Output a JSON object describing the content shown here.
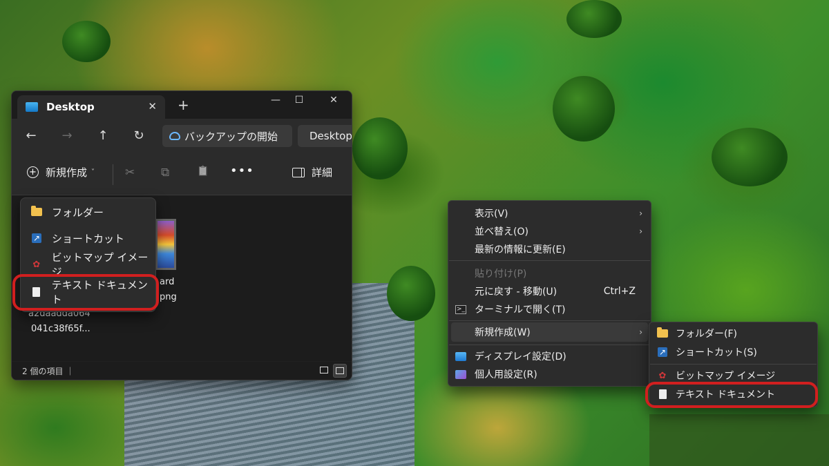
{
  "explorer": {
    "tab_title": "Desktop",
    "tab_close": "✕",
    "new_tab": "+",
    "window_controls": {
      "minimize": "—",
      "maximize": "☐",
      "close": "✕"
    },
    "nav": {
      "back": "←",
      "forward": "→",
      "up": "↑",
      "refresh": "↻"
    },
    "backup_button": "バックアップの開始",
    "address": "Desktop",
    "toolbar": {
      "new_label": "新規作成",
      "new_caret": "˅",
      "cut_glyph": "✂",
      "copy_glyph": "⧉",
      "paste_glyph": "📋",
      "more": "•••",
      "details_label": "詳細"
    },
    "files": [
      {
        "line1": "ard",
        "line2": "png"
      },
      {
        "line1": "a2daadda064",
        "line2": "041c38f65f..."
      }
    ],
    "status_text": "2 個の項目 ｜"
  },
  "new_menu": {
    "items": [
      {
        "label": "フォルダー",
        "icon": "folder-icon"
      },
      {
        "label": "ショートカット",
        "icon": "shortcut-icon"
      },
      {
        "label": "ビットマップ イメージ",
        "icon": "bitmap-icon"
      },
      {
        "label": "テキスト ドキュメント",
        "icon": "text-document-icon"
      }
    ]
  },
  "context_menu": {
    "items": [
      {
        "label": "表示(V)",
        "arrow": "›"
      },
      {
        "label": "並べ替え(O)",
        "arrow": "›"
      },
      {
        "label": "最新の情報に更新(E)"
      },
      {
        "label": "貼り付け(P)",
        "disabled": true
      },
      {
        "label": "元に戻す - 移動(U)",
        "accel": "Ctrl+Z"
      },
      {
        "label": "ターミナルで開く(T)",
        "icon": "terminal-icon"
      },
      {
        "label": "新規作成(W)",
        "arrow": "›"
      },
      {
        "label": "ディスプレイ設定(D)",
        "icon": "display-icon"
      },
      {
        "label": "個人用設定(R)",
        "icon": "personalize-icon"
      }
    ]
  },
  "submenu": {
    "items": [
      {
        "label": "フォルダー(F)",
        "icon": "folder-icon"
      },
      {
        "label": "ショートカット(S)",
        "icon": "shortcut-icon"
      },
      {
        "label": "ビットマップ イメージ",
        "icon": "bitmap-icon"
      },
      {
        "label": "テキスト ドキュメント",
        "icon": "text-document-icon"
      }
    ]
  },
  "colors": {
    "highlight_ring": "#d11f1f",
    "folder": "#f2c14e",
    "accent": "#2a6ebb"
  }
}
